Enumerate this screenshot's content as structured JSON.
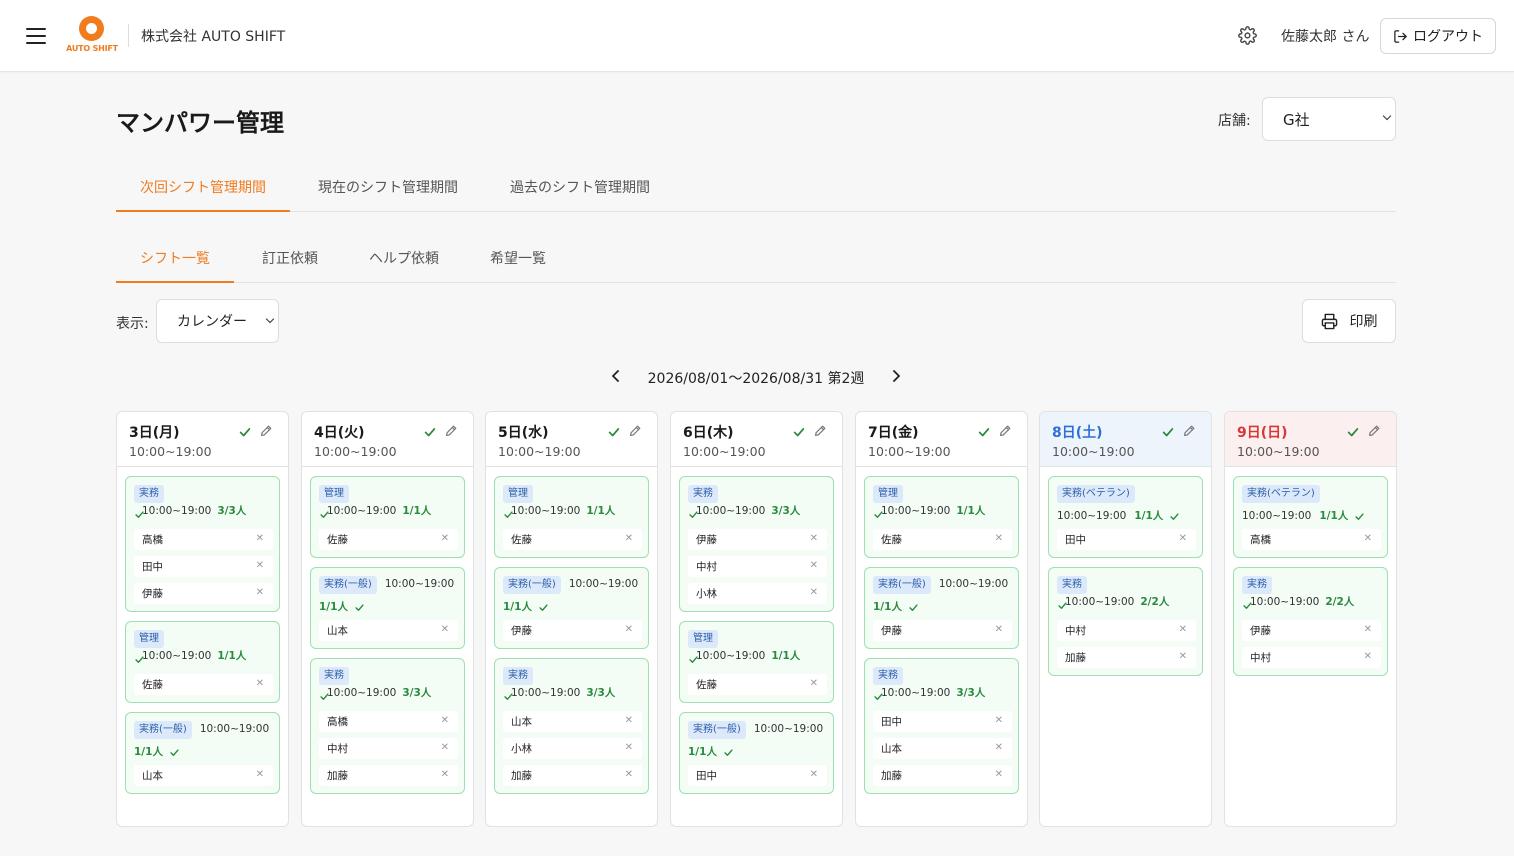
{
  "header": {
    "logo_text": "AUTO SHIFT",
    "company": "株式会社 AUTO SHIFT",
    "user": "佐藤太郎 さん",
    "logout_label": "ログアウト"
  },
  "page": {
    "title": "マンパワー管理",
    "store_label": "店舗:",
    "store_value": "G社"
  },
  "period_tabs": [
    "次回シフト管理期間",
    "現在のシフト管理期間",
    "過去のシフト管理期間"
  ],
  "sub_tabs": [
    "シフト一覧",
    "訂正依頼",
    "ヘルプ依頼",
    "希望一覧"
  ],
  "view": {
    "label": "表示:",
    "value": "カレンダー",
    "print_label": "印刷"
  },
  "week_label": "2026/08/01〜2026/08/31 第2週",
  "colors": {
    "accent": "#f07c1e",
    "saturday": "#2f6fd8",
    "sunday": "#d93636",
    "count_green": "#2a8a3e",
    "card_border": "#9ee0b0",
    "badge_bg": "#dce9fb"
  },
  "days": [
    {
      "label": "3日(月)",
      "hours": "10:00~19:00",
      "kind": "weekday",
      "shifts": [
        {
          "role": "実務",
          "time": "10:00~19:00",
          "count": "3/3人",
          "people": [
            "高橋",
            "田中",
            "伊藤"
          ]
        },
        {
          "role": "管理",
          "time": "10:00~19:00",
          "count": "1/1人",
          "people": [
            "佐藤"
          ]
        },
        {
          "role": "実務(一般)",
          "time": "10:00~19:00",
          "count": "1/1人",
          "people": [
            "山本"
          ]
        }
      ]
    },
    {
      "label": "4日(火)",
      "hours": "10:00~19:00",
      "kind": "weekday",
      "shifts": [
        {
          "role": "管理",
          "time": "10:00~19:00",
          "count": "1/1人",
          "people": [
            "佐藤"
          ]
        },
        {
          "role": "実務(一般)",
          "time": "10:00~19:00",
          "count": "1/1人",
          "people": [
            "山本"
          ]
        },
        {
          "role": "実務",
          "time": "10:00~19:00",
          "count": "3/3人",
          "people": [
            "高橋",
            "中村",
            "加藤"
          ]
        }
      ]
    },
    {
      "label": "5日(水)",
      "hours": "10:00~19:00",
      "kind": "weekday",
      "shifts": [
        {
          "role": "管理",
          "time": "10:00~19:00",
          "count": "1/1人",
          "people": [
            "佐藤"
          ]
        },
        {
          "role": "実務(一般)",
          "time": "10:00~19:00",
          "count": "1/1人",
          "people": [
            "伊藤"
          ]
        },
        {
          "role": "実務",
          "time": "10:00~19:00",
          "count": "3/3人",
          "people": [
            "山本",
            "小林",
            "加藤"
          ]
        }
      ]
    },
    {
      "label": "6日(木)",
      "hours": "10:00~19:00",
      "kind": "weekday",
      "shifts": [
        {
          "role": "実務",
          "time": "10:00~19:00",
          "count": "3/3人",
          "people": [
            "伊藤",
            "中村",
            "小林"
          ]
        },
        {
          "role": "管理",
          "time": "10:00~19:00",
          "count": "1/1人",
          "people": [
            "佐藤"
          ]
        },
        {
          "role": "実務(一般)",
          "time": "10:00~19:00",
          "count": "1/1人",
          "people": [
            "田中"
          ]
        }
      ]
    },
    {
      "label": "7日(金)",
      "hours": "10:00~19:00",
      "kind": "weekday",
      "shifts": [
        {
          "role": "管理",
          "time": "10:00~19:00",
          "count": "1/1人",
          "people": [
            "佐藤"
          ]
        },
        {
          "role": "実務(一般)",
          "time": "10:00~19:00",
          "count": "1/1人",
          "people": [
            "伊藤"
          ]
        },
        {
          "role": "実務",
          "time": "10:00~19:00",
          "count": "3/3人",
          "people": [
            "田中",
            "山本",
            "加藤"
          ]
        }
      ]
    },
    {
      "label": "8日(土)",
      "hours": "10:00~19:00",
      "kind": "saturday",
      "shifts": [
        {
          "role": "実務(ベテラン)",
          "time": "10:00~19:00",
          "count": "1/1人",
          "people": [
            "田中"
          ]
        },
        {
          "role": "実務",
          "time": "10:00~19:00",
          "count": "2/2人",
          "people": [
            "中村",
            "加藤"
          ]
        }
      ]
    },
    {
      "label": "9日(日)",
      "hours": "10:00~19:00",
      "kind": "sunday",
      "shifts": [
        {
          "role": "実務(ベテラン)",
          "time": "10:00~19:00",
          "count": "1/1人",
          "people": [
            "高橋"
          ]
        },
        {
          "role": "実務",
          "time": "10:00~19:00",
          "count": "2/2人",
          "people": [
            "伊藤",
            "中村"
          ]
        }
      ]
    }
  ]
}
